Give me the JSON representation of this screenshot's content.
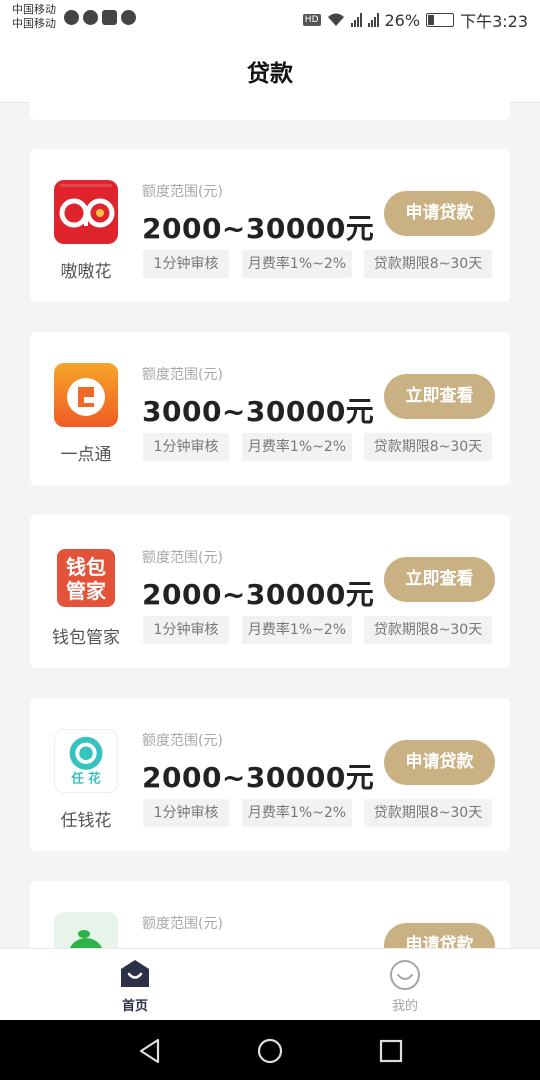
{
  "status_bar": {
    "carrier_1": "中国移动",
    "carrier_2": "中国移动",
    "battery": "26%",
    "time": "下午3:23"
  },
  "header": {
    "title": "贷款"
  },
  "range_label": "额度范围(元)",
  "loans": [
    {
      "name": "嗷嗷花",
      "logo": "aohua-logo",
      "amount": "2000~30000元",
      "button": "申请贷款",
      "tags": [
        "1分钟审核",
        "月费率1%~2%",
        "贷款期限8~30天"
      ]
    },
    {
      "name": "一点通",
      "logo": "yidiantong-logo",
      "amount": "3000~30000元",
      "button": "立即查看",
      "tags": [
        "1分钟审核",
        "月费率1%~2%",
        "贷款期限8~30天"
      ]
    },
    {
      "name": "钱包管家",
      "logo": "qianbaoguanjia-logo",
      "amount": "2000~30000元",
      "button": "立即查看",
      "tags": [
        "1分钟审核",
        "月费率1%~2%",
        "贷款期限8~30天"
      ]
    },
    {
      "name": "任钱花",
      "logo": "renqianhua-logo",
      "amount": "2000~30000元",
      "button": "申请贷款",
      "tags": [
        "1分钟审核",
        "月费率1%~2%",
        "贷款期限8~30天"
      ]
    },
    {
      "name": "",
      "logo": "orange-logo",
      "amount": "",
      "button": "申请贷款",
      "tags": []
    }
  ],
  "tabs": [
    {
      "label": "首页",
      "icon": "home-icon",
      "active": true
    },
    {
      "label": "我的",
      "icon": "smile-icon",
      "active": false
    }
  ],
  "colors": {
    "accent": "#c9b183",
    "tab_active": "#2d3147"
  },
  "logo_text": {
    "qianbao_top": "钱包",
    "qianbao_bottom": "管家",
    "renqianhua": "任 花"
  }
}
